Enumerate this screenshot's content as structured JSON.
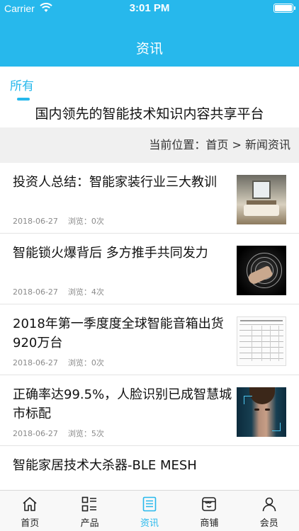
{
  "status_bar": {
    "carrier": "Carrier",
    "time": "3:01 PM"
  },
  "nav": {
    "title": "资讯"
  },
  "tabs": [
    {
      "label": "所有"
    }
  ],
  "slogan": "国内领先的智能技术知识内容共享平台",
  "breadcrumb": {
    "prefix": "当前位置：",
    "home": "首页",
    "separator": " > ",
    "current": "新闻资讯"
  },
  "news": [
    {
      "title": "投资人总结：智能家装行业三大教训",
      "date": "2018-06-27",
      "views": "浏览：0次"
    },
    {
      "title": "智能锁火爆背后 多方推手共同发力",
      "date": "2018-06-27",
      "views": "浏览：4次"
    },
    {
      "title": "2018年第一季度度全球智能音箱出货920万台",
      "date": "2018-06-27",
      "views": "浏览：0次"
    },
    {
      "title": "正确率达99.5%，人脸识别已成智慧城市标配",
      "date": "2018-06-27",
      "views": "浏览：5次"
    },
    {
      "title": "智能家居技术大杀器-BLE MESH"
    }
  ],
  "tabbar": [
    {
      "label": "首页",
      "icon": "home-icon"
    },
    {
      "label": "产品",
      "icon": "grid-list-icon"
    },
    {
      "label": "资讯",
      "icon": "document-icon",
      "active": true
    },
    {
      "label": "商铺",
      "icon": "store-icon"
    },
    {
      "label": "会员",
      "icon": "user-icon"
    }
  ],
  "colors": {
    "accent": "#27b8ec",
    "breadcrumb_bg": "#f0f0f0",
    "meta_text": "#8a8a8a"
  }
}
